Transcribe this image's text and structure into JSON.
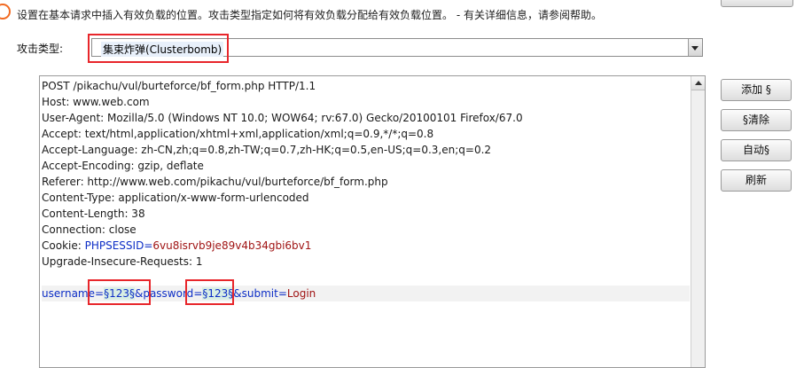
{
  "header": {
    "help_text": "设置在基本请求中插入有效负载的位置。攻击类型指定如何将有效负载分配给有效负载位置。 - 有关详细信息，请参阅帮助。"
  },
  "attack": {
    "label": "攻击类型:",
    "selected": "集束炸弹(Clusterbomb)"
  },
  "request": {
    "lines": [
      "POST /pikachu/vul/burteforce/bf_form.php HTTP/1.1",
      "Host: www.web.com",
      "User-Agent: Mozilla/5.0 (Windows NT 10.0; WOW64; rv:67.0) Gecko/20100101 Firefox/67.0",
      "Accept: text/html,application/xhtml+xml,application/xml;q=0.9,*/*;q=0.8",
      "Accept-Language: zh-CN,zh;q=0.8,zh-TW;q=0.7,zh-HK;q=0.5,en-US;q=0.3,en;q=0.2",
      "Accept-Encoding: gzip, deflate",
      "Referer: http://www.web.com/pikachu/vul/burteforce/bf_form.php",
      "Content-Type: application/x-www-form-urlencoded",
      "Content-Length: 38",
      "Connection: close"
    ],
    "cookie_prefix": "Cookie: ",
    "cookie_key": "PHPSESSID",
    "cookie_eq": "=",
    "cookie_value": "6vu8isrvb9je89v4b34gbi6bv1",
    "upgrade_line": "Upgrade-Insecure-Requests: 1",
    "body": {
      "username_key": "username",
      "eq1": "=",
      "username_marker": "§123§",
      "amp1": "&",
      "password_key": "password",
      "eq2": "=",
      "password_marker": "§123§",
      "amp2": "&",
      "submit_key": "submit",
      "eq3": "=",
      "submit_value": "Login"
    }
  },
  "buttons": {
    "add": "添加 §",
    "clear": "§清除",
    "auto": "自动§",
    "refresh": "刷新"
  },
  "colors": {
    "highlight_box": "#e8262b",
    "param_key": "#0d2ec6",
    "param_value": "#a01414",
    "help_icon": "#f26a21"
  }
}
